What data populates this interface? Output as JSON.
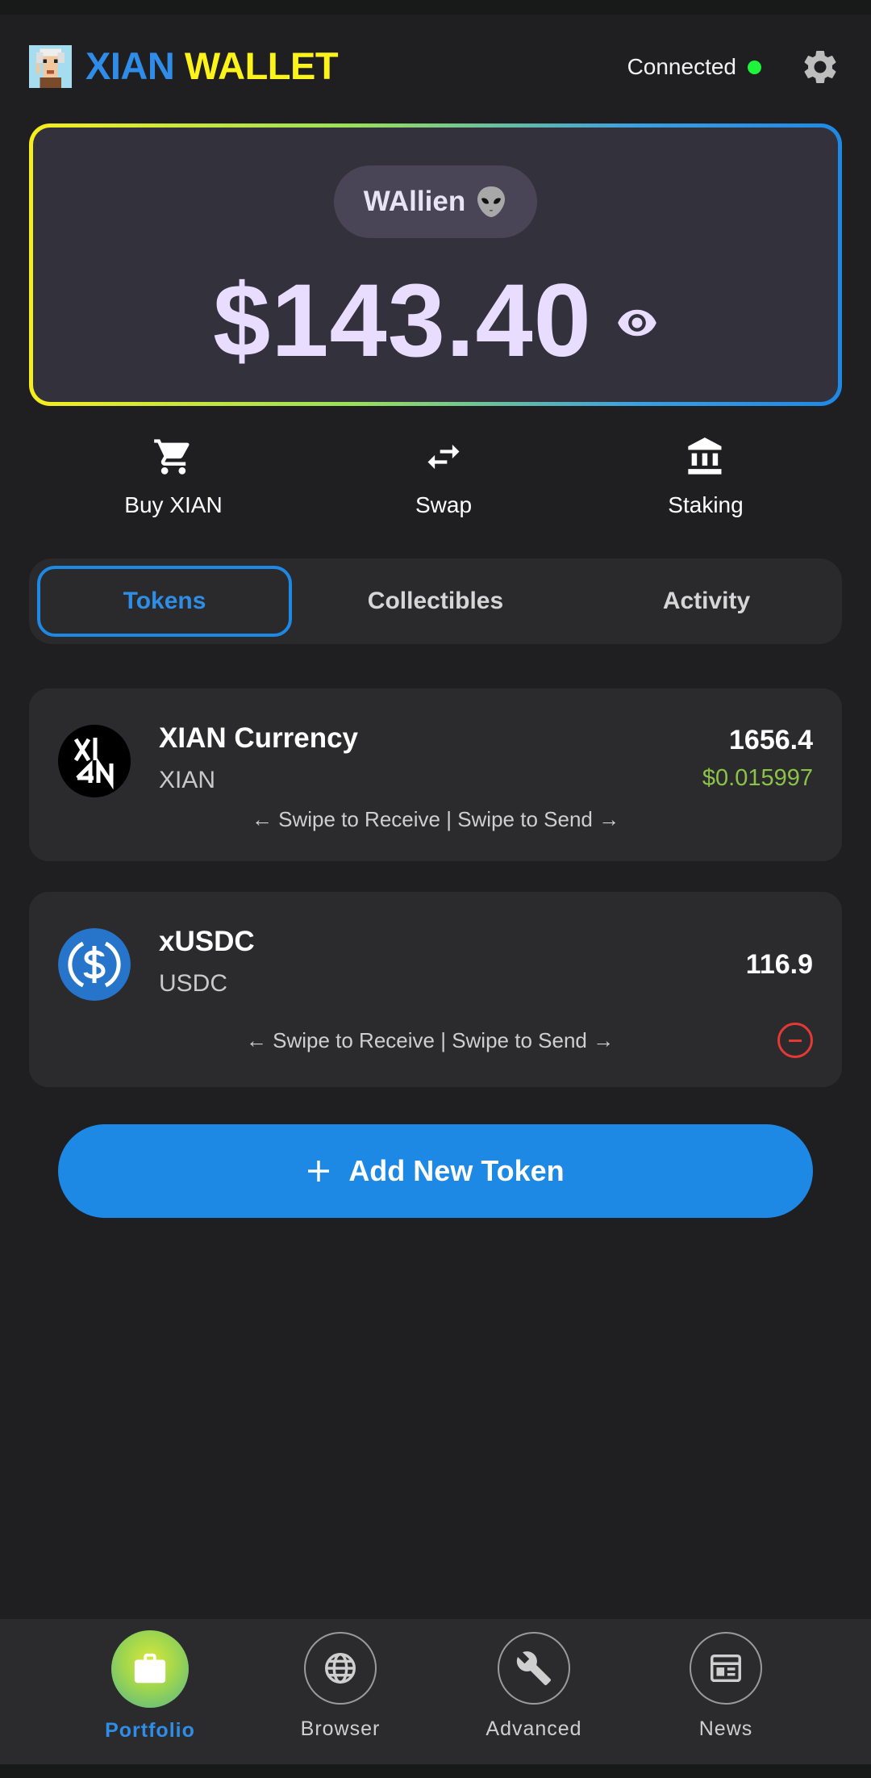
{
  "header": {
    "brand_part1": "XIAN",
    "brand_part2": "WALLET",
    "status": "Connected"
  },
  "balance_card": {
    "account_name": "WAllien",
    "balance": "$143.40"
  },
  "actions": [
    {
      "label": "Buy XIAN",
      "icon": "cart-icon"
    },
    {
      "label": "Swap",
      "icon": "swap-icon"
    },
    {
      "label": "Staking",
      "icon": "bank-icon"
    }
  ],
  "tabs": [
    {
      "label": "Tokens",
      "active": true
    },
    {
      "label": "Collectibles",
      "active": false
    },
    {
      "label": "Activity",
      "active": false
    }
  ],
  "tokens": [
    {
      "name": "XIAN Currency",
      "symbol": "XIAN",
      "amount": "1656.4",
      "price": "$0.015997",
      "hint": "← Swipe to Receive | Swipe to Send →"
    },
    {
      "name": "xUSDC",
      "symbol": "USDC",
      "amount": "116.9",
      "hint": "← Swipe to Receive | Swipe to Send →"
    }
  ],
  "add_token": {
    "label": "Add New Token"
  },
  "nav": [
    {
      "label": "Portfolio",
      "icon": "briefcase-icon",
      "active": true
    },
    {
      "label": "Browser",
      "icon": "globe-icon",
      "active": false
    },
    {
      "label": "Advanced",
      "icon": "wrench-icon",
      "active": false
    },
    {
      "label": "News",
      "icon": "newspaper-icon",
      "active": false
    }
  ],
  "colors": {
    "background": "#1f1f21",
    "accent_blue": "#1e88e5",
    "brand_yellow": "#fbf319",
    "connected_green": "#1ef43b",
    "price_green": "#8bc34a",
    "remove_red": "#e53935"
  }
}
